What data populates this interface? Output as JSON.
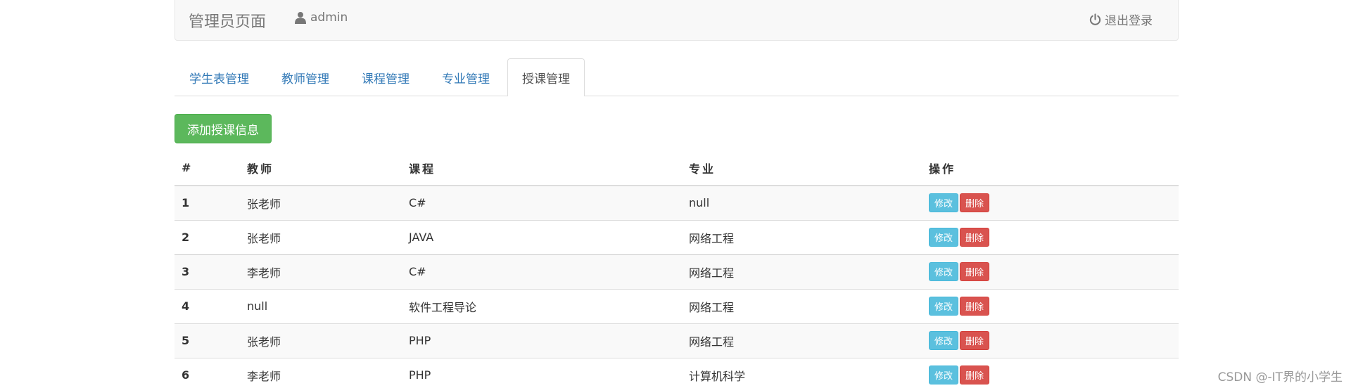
{
  "navbar": {
    "brand": "管理员页面",
    "user": "admin",
    "user_icon": "user-icon",
    "logout": "退出登录",
    "logout_icon": "power-icon"
  },
  "tabs": [
    {
      "label": "学生表管理",
      "active": false
    },
    {
      "label": "教师管理",
      "active": false
    },
    {
      "label": "课程管理",
      "active": false
    },
    {
      "label": "专业管理",
      "active": false
    },
    {
      "label": "授课管理",
      "active": true
    }
  ],
  "add_button": "添加授课信息",
  "table": {
    "headers": [
      "#",
      "教师",
      "课程",
      "专业",
      "操作"
    ],
    "edit_label": "修改",
    "delete_label": "删除",
    "rows": [
      {
        "id": "1",
        "teacher": "张老师",
        "course": "C#",
        "major": "null"
      },
      {
        "id": "2",
        "teacher": "张老师",
        "course": "JAVA",
        "major": "网络工程"
      },
      {
        "id": "3",
        "teacher": "李老师",
        "course": "C#",
        "major": "网络工程"
      },
      {
        "id": "4",
        "teacher": "null",
        "course": "软件工程导论",
        "major": "网络工程"
      },
      {
        "id": "5",
        "teacher": "张老师",
        "course": "PHP",
        "major": "网络工程"
      },
      {
        "id": "6",
        "teacher": "李老师",
        "course": "PHP",
        "major": "计算机科学"
      }
    ]
  },
  "watermark": "CSDN @-IT界的小学生",
  "colors": {
    "primary_link": "#337ab7",
    "success": "#5cb85c",
    "info": "#5bc0de",
    "danger": "#d9534f"
  }
}
